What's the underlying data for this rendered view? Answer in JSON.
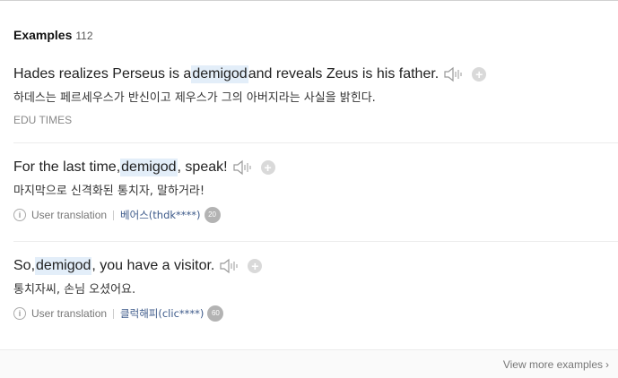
{
  "header": {
    "title": "Examples",
    "count": "112"
  },
  "examples": [
    {
      "en_pre": "Hades realizes Perseus is a ",
      "en_hl": "demigod",
      "en_post": " and reveals Zeus is his father.",
      "ko": "하데스는 페르세우스가 반신이고 제우스가 그의 아버지라는 사실을 밝힌다.",
      "source": "EDU TIMES"
    },
    {
      "en_pre": "For the last time, ",
      "en_hl": "demigod",
      "en_post": ", speak!",
      "ko": "마지막으로 신격화된 통치자, 말하거라!",
      "meta_label": "User translation",
      "user": "베어스(thdk****)",
      "badge": "20"
    },
    {
      "en_pre": "So, ",
      "en_hl": "demigod",
      "en_post": ", you have a visitor.",
      "ko": "통치자씨, 손님 오셨어요.",
      "meta_label": "User translation",
      "user": "클럭해피(clic****)",
      "badge": "60"
    }
  ],
  "footer": {
    "view_more": "View more examples",
    "chevron": "›"
  },
  "icons": {
    "speaker": "speaker-icon",
    "plus": "+",
    "info": "i"
  }
}
